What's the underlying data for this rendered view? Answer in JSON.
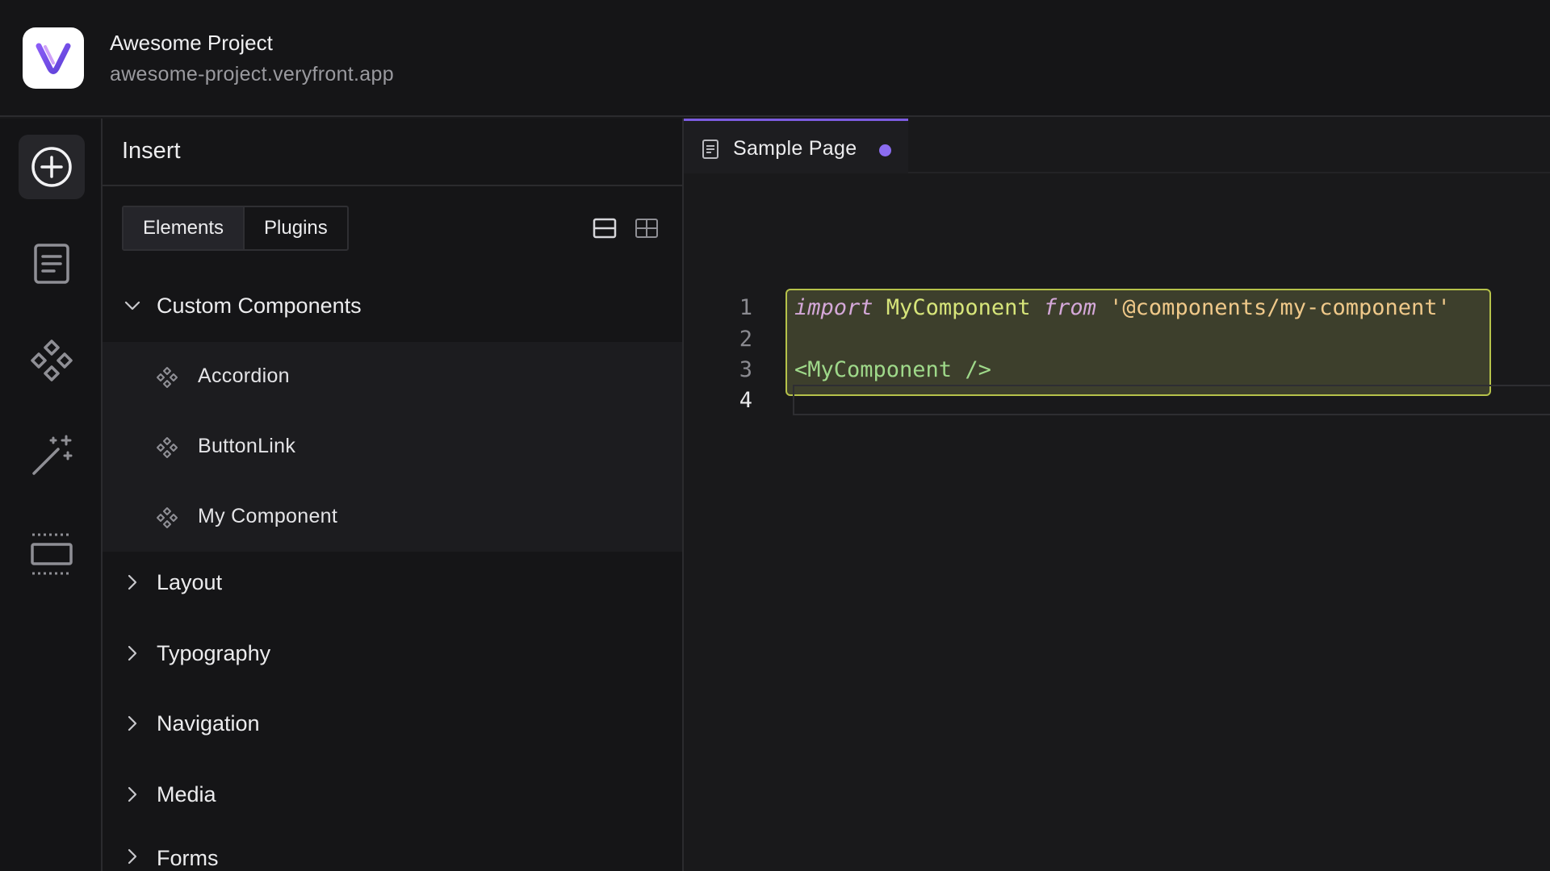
{
  "project": {
    "name": "Awesome Project",
    "url": "awesome-project.veryfront.app"
  },
  "rail": {
    "items": [
      {
        "icon": "plus-circle-icon",
        "active": true
      },
      {
        "icon": "document-icon",
        "active": false
      },
      {
        "icon": "components-icon",
        "active": false
      },
      {
        "icon": "magic-wand-icon",
        "active": false
      },
      {
        "icon": "section-layout-icon",
        "active": false
      }
    ]
  },
  "panel": {
    "title": "Insert",
    "tabs": [
      {
        "label": "Elements",
        "active": true
      },
      {
        "label": "Plugins",
        "active": false
      }
    ],
    "view_toggles": [
      "list-view-icon",
      "grid-view-icon"
    ],
    "sections": [
      {
        "label": "Custom Components",
        "expanded": true,
        "items": [
          "Accordion",
          "ButtonLink",
          "My Component"
        ]
      },
      {
        "label": "Layout",
        "expanded": false
      },
      {
        "label": "Typography",
        "expanded": false
      },
      {
        "label": "Navigation",
        "expanded": false
      },
      {
        "label": "Media",
        "expanded": false
      },
      {
        "label": "Forms",
        "expanded": false
      }
    ]
  },
  "editor": {
    "tab": {
      "label": "Sample Page",
      "unsaved": true
    },
    "line_numbers": [
      "1",
      "2",
      "3",
      "4"
    ],
    "lines": {
      "l1": {
        "kw1": "import",
        "ident": " MyComponent ",
        "kw2": "from",
        "str": " '@components/my-component'"
      },
      "l3": {
        "tag": "<MyComponent />"
      }
    }
  },
  "colors": {
    "accent": "#7c5ce0",
    "highlight_border": "#b6c24a",
    "highlight_fill": "#3d3f2c"
  }
}
